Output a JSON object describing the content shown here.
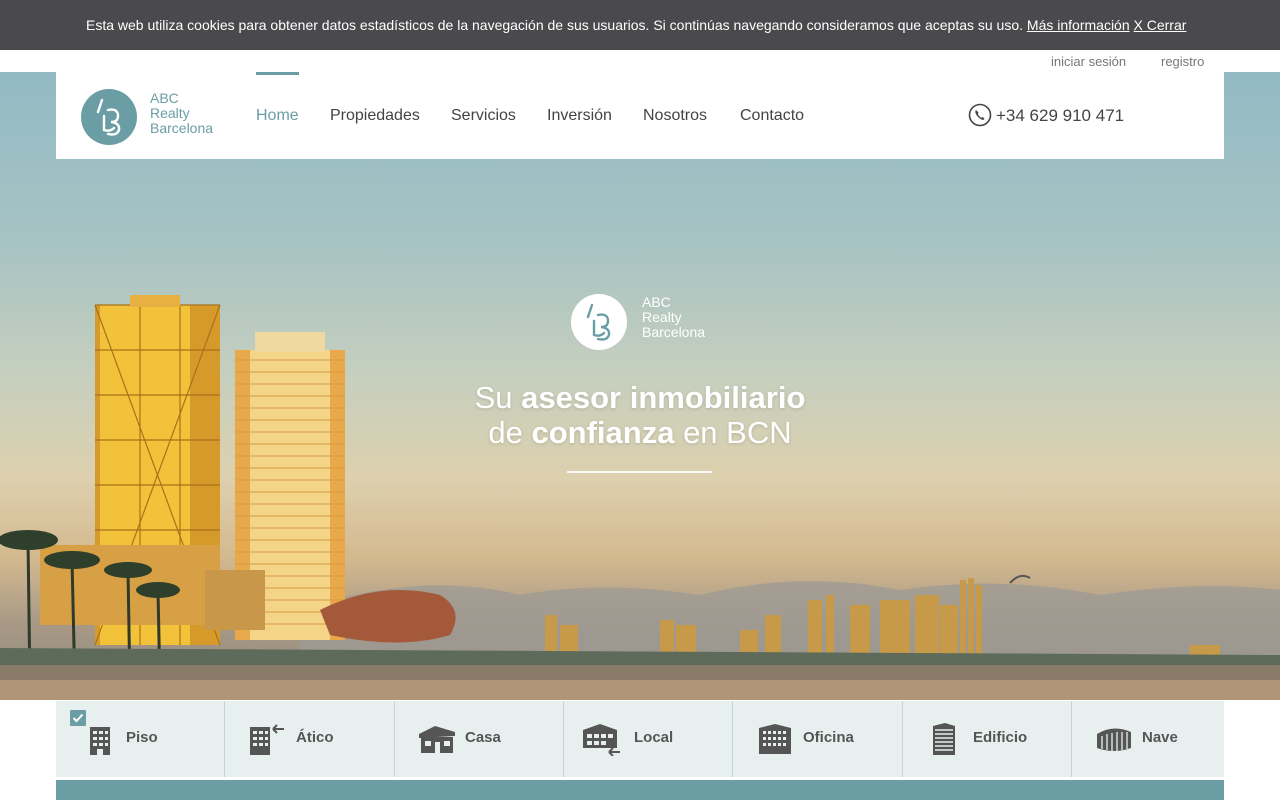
{
  "cookie": {
    "message": "Esta web utiliza cookies para obtener datos estadísticos de la navegación de sus usuarios. Si continúas navegando consideramos que aceptas su uso.",
    "more_info": "Más información",
    "close": "X Cerrar"
  },
  "account": {
    "login": "iniciar sesión",
    "register": "registro"
  },
  "brand": {
    "line1": "ABC",
    "line2": "Realty",
    "line3": "Barcelona"
  },
  "nav": {
    "home": "Home",
    "propiedades": "Propiedades",
    "servicios": "Servicios",
    "inversion": "Inversión",
    "nosotros": "Nosotros",
    "contacto": "Contacto"
  },
  "phone": "+34 629 910 471",
  "hero": {
    "t1": "Su ",
    "t2": "asesor inmobiliario",
    "t3": "de ",
    "t4": "confianza",
    "t5": " en BCN"
  },
  "types": [
    {
      "label": "Piso",
      "checked": true,
      "icon": "apartment-icon"
    },
    {
      "label": "Ático",
      "checked": false,
      "icon": "penthouse-icon"
    },
    {
      "label": "Casa",
      "checked": false,
      "icon": "house-icon"
    },
    {
      "label": "Local",
      "checked": false,
      "icon": "commercial-premises-icon"
    },
    {
      "label": "Oficina",
      "checked": false,
      "icon": "office-icon"
    },
    {
      "label": "Edificio",
      "checked": false,
      "icon": "building-icon"
    },
    {
      "label": "Nave",
      "checked": false,
      "icon": "warehouse-icon"
    }
  ],
  "colors": {
    "accent": "#6a9ea4",
    "cookie_bg": "#4a4a4d",
    "type_bar_bg": "#e8f0ef",
    "text": "#444444"
  }
}
